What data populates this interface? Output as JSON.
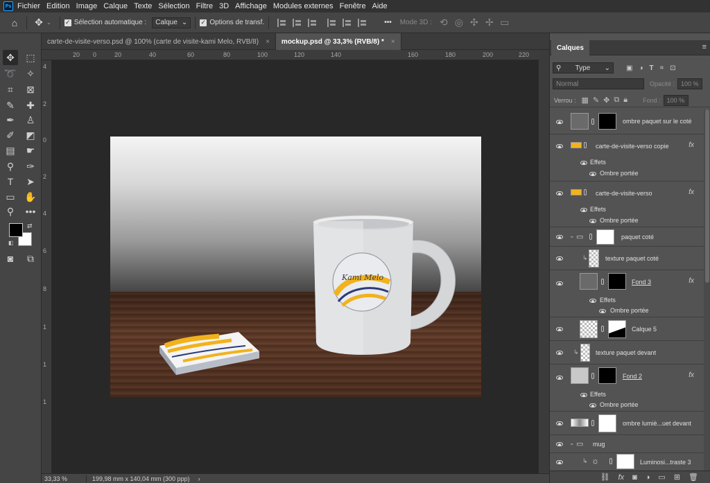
{
  "app": {
    "logo": "Ps"
  },
  "menu": [
    "Fichier",
    "Edition",
    "Image",
    "Calque",
    "Texte",
    "Sélection",
    "Filtre",
    "3D",
    "Affichage",
    "Modules externes",
    "Fenêtre",
    "Aide"
  ],
  "options": {
    "auto_select_label": "Sélection automatique :",
    "auto_select_value": "Calque",
    "transform_label": "Options de transf.",
    "more": "•••",
    "mode3d_label": "Mode 3D :"
  },
  "tabs": [
    {
      "label": "carte-de-visite-verso.psd @ 100% (carte de visite-kami Melo, RVB/8)",
      "close": "×"
    },
    {
      "label": "mockup.psd @ 33,3% (RVB/8) *",
      "close": "×"
    }
  ],
  "ruler_top": [
    "20",
    "0",
    "20",
    "40",
    "60",
    "80",
    "100",
    "120",
    "140",
    "160",
    "180",
    "200",
    "220"
  ],
  "ruler_left": [
    "4",
    "2",
    "0",
    "2",
    "4",
    "6",
    "8",
    "1",
    "1",
    "1"
  ],
  "status": {
    "zoom": "33,33 %",
    "doc_size": "199,98 mm x 140,04 mm (300 ppp)",
    "arrow": "›"
  },
  "artwork": {
    "mug_logo_text": "Kami Melo"
  },
  "panel": {
    "tab": "Calques",
    "menu_icon": "≡",
    "filter_label": "Type",
    "blend_mode": "Normal",
    "opacity_label": "Opacité :",
    "opacity_value": "100 %",
    "lock_label": "Verrou :",
    "fill_label": "Fond :",
    "fill_value": "100 %"
  },
  "layers": [
    {
      "name": "ombre paquet sur le coté",
      "top": 0
    },
    {
      "name": "carte-de-visite-verso copie",
      "fx": "fx",
      "effects": "Effets",
      "effect": "Ombre portée"
    },
    {
      "name": "carte-de-visite-verso",
      "fx": "fx",
      "effects": "Effets",
      "effect": "Ombre portée"
    },
    {
      "name": "paquet coté"
    },
    {
      "name": "texture paquet coté"
    },
    {
      "name": "Fond 3",
      "fx": "fx",
      "effects": "Effets",
      "effect": "Ombre portée"
    },
    {
      "name": "Calque 5"
    },
    {
      "name": "texture paquet devant"
    },
    {
      "name": "Fond 2",
      "fx": "fx",
      "effects": "Effets",
      "effect": "Ombre portée"
    },
    {
      "name": "ombre lumiè...uet devant"
    },
    {
      "name": "mug"
    },
    {
      "name": "Luminosi...traste 3"
    }
  ],
  "colors": {
    "accent": "#31a8ff",
    "panel_bg": "#535353",
    "canvas_bg": "#282828"
  }
}
